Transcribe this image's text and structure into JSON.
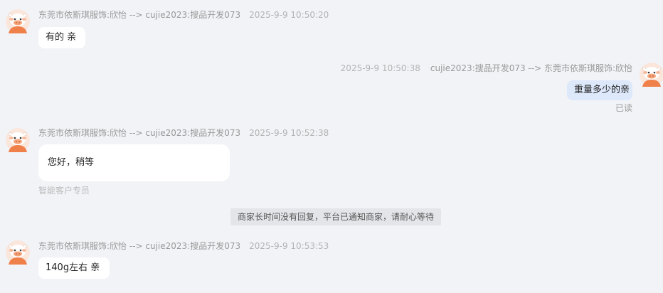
{
  "messages": [
    {
      "sender": "东莞市依斯琪服饰:欣怡 --> cujie2023:搜品开发073",
      "time": "2025-9-9 10:50:20",
      "text": "有的 亲"
    },
    {
      "sender": "cujie2023:搜品开发073 --> 东莞市依斯琪服饰:欣怡",
      "time": "2025-9-9 10:50:38",
      "text": "重量多少的亲",
      "status": "已读"
    },
    {
      "sender": "东莞市依斯琪服饰:欣怡 --> cujie2023:搜品开发073",
      "time": "2025-9-9 10:52:38",
      "text": "您好，稍等",
      "footer": "智能客户专员"
    },
    {
      "system_text": "商家长时间没有回复，平台已通知商家，请耐心等待"
    },
    {
      "sender": "东莞市依斯琪服饰:欣怡 --> cujie2023:搜品开发073",
      "time": "2025-9-9 10:53:53",
      "text": "140g左右 亲"
    }
  ],
  "icons": {
    "avatar": "cow-mascot-avatar-icon"
  },
  "colors": {
    "background": "#f2f3f7",
    "bubble_received": "#ffffff",
    "bubble_sent": "#dde8fb",
    "system_notice_bg": "#e4e5e9",
    "avatar_primary": "#f0804a"
  }
}
